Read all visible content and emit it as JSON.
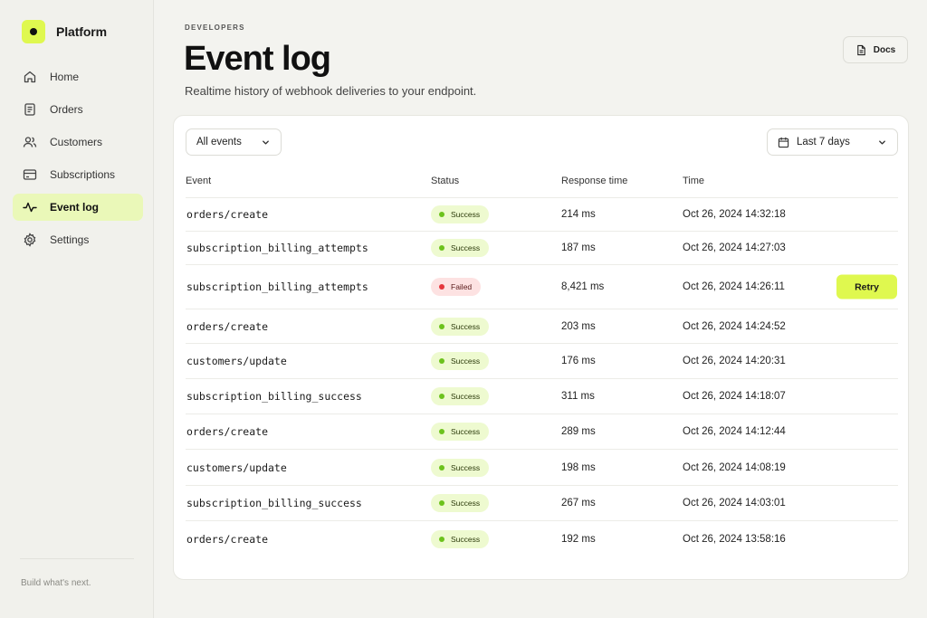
{
  "brand": {
    "name": "Platform"
  },
  "sidebar": {
    "items": [
      {
        "label": "Home",
        "icon": "home-icon",
        "active": false
      },
      {
        "label": "Orders",
        "icon": "document-icon",
        "active": false
      },
      {
        "label": "Customers",
        "icon": "users-icon",
        "active": false
      },
      {
        "label": "Subscriptions",
        "icon": "credit-card-icon",
        "active": false
      },
      {
        "label": "Event log",
        "icon": "activity-icon",
        "active": true
      },
      {
        "label": "Settings",
        "icon": "gear-icon",
        "active": false
      }
    ],
    "tagline": "Build what's next."
  },
  "header": {
    "eyebrow": "DEVELOPERS",
    "title": "Event log",
    "subtitle": "Realtime history of webhook deliveries to your endpoint.",
    "docs_label": "Docs"
  },
  "filters": {
    "event_filter": "All events",
    "date_range": "Last 7 days"
  },
  "table": {
    "columns": [
      "Event",
      "Status",
      "Response time",
      "Time"
    ],
    "rows": [
      {
        "event": "orders/create",
        "status": "Success",
        "response_time": "214 ms",
        "time": "Oct 26, 2024 14:32:18"
      },
      {
        "event": "subscription_billing_attempts",
        "status": "Success",
        "response_time": "187 ms",
        "time": "Oct 26, 2024 14:27:03"
      },
      {
        "event": "subscription_billing_attempts",
        "status": "Failed",
        "response_time": "8,421 ms",
        "time": "Oct 26, 2024 14:26:11",
        "action": "Retry"
      },
      {
        "event": "orders/create",
        "status": "Success",
        "response_time": "203 ms",
        "time": "Oct 26, 2024 14:24:52"
      },
      {
        "event": "customers/update",
        "status": "Success",
        "response_time": "176 ms",
        "time": "Oct 26, 2024 14:20:31"
      },
      {
        "event": "subscription_billing_success",
        "status": "Success",
        "response_time": "311 ms",
        "time": "Oct 26, 2024 14:18:07"
      },
      {
        "event": "orders/create",
        "status": "Success",
        "response_time": "289 ms",
        "time": "Oct 26, 2024 14:12:44"
      },
      {
        "event": "customers/update",
        "status": "Success",
        "response_time": "198 ms",
        "time": "Oct 26, 2024 14:08:19"
      },
      {
        "event": "subscription_billing_success",
        "status": "Success",
        "response_time": "267 ms",
        "time": "Oct 26, 2024 14:03:01"
      },
      {
        "event": "orders/create",
        "status": "Success",
        "response_time": "192 ms",
        "time": "Oct 26, 2024 13:58:16"
      }
    ]
  },
  "colors": {
    "accent": "#dff84f",
    "success": "#6cc21c",
    "failed": "#e5363c"
  }
}
